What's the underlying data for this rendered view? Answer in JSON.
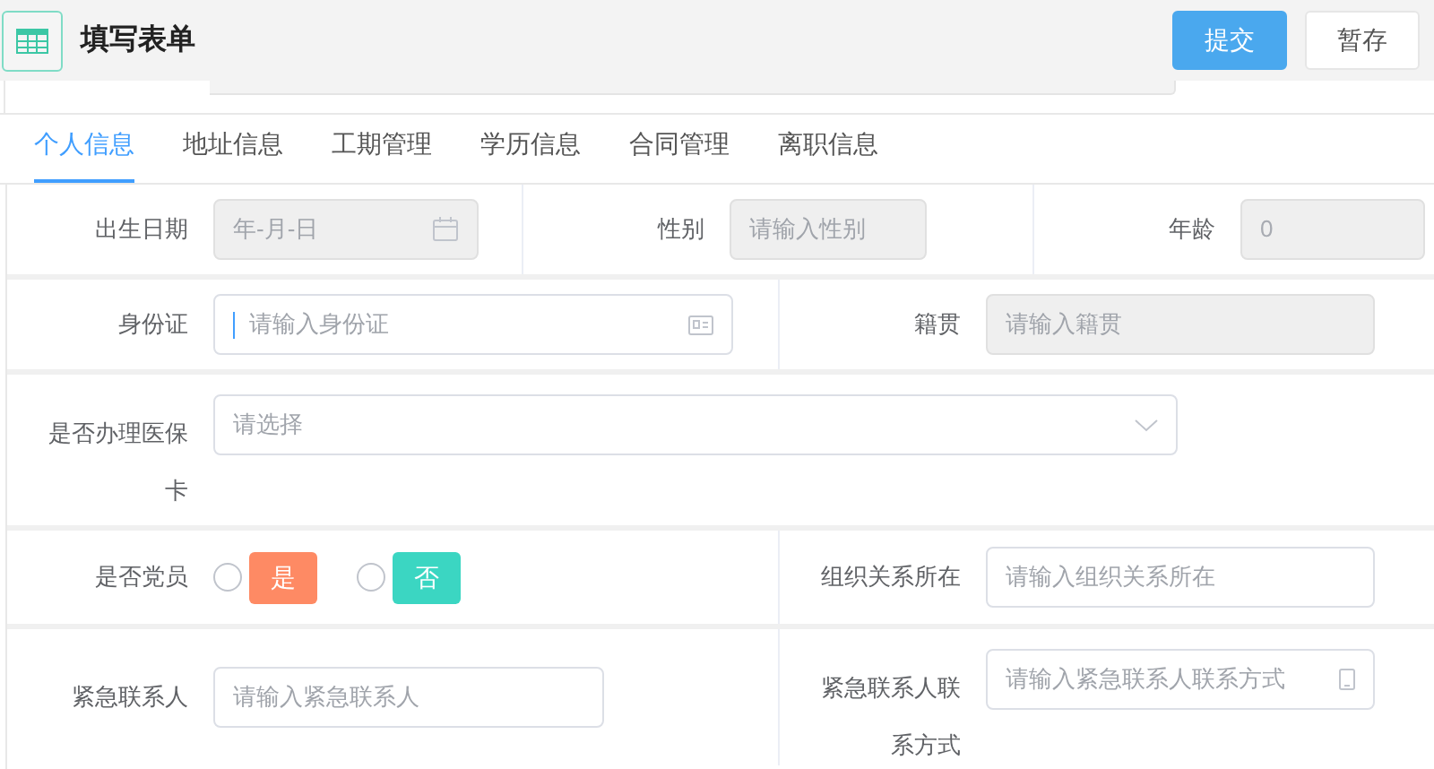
{
  "header": {
    "title": "填写表单",
    "buttons": [
      {
        "label": "提交",
        "kind": "primary"
      },
      {
        "label": "暂存",
        "kind": "default"
      }
    ]
  },
  "tabs": [
    {
      "label": "个人信息",
      "selected": true
    },
    {
      "label": "地址信息",
      "selected": false
    },
    {
      "label": "工期管理",
      "selected": false
    },
    {
      "label": "学历信息",
      "selected": false
    },
    {
      "label": "合同管理",
      "selected": false
    },
    {
      "label": "离职信息",
      "selected": false
    }
  ],
  "rows": [
    {
      "cells": [
        {
          "label": "出生日期",
          "kind": "date",
          "placeholder": "年-月-日",
          "disabled": true
        },
        {
          "label": "性别",
          "kind": "text",
          "placeholder": "请输入性别",
          "disabled": true
        },
        {
          "label": "年龄",
          "kind": "text",
          "value": "0",
          "disabled": true
        }
      ]
    },
    {
      "cells": [
        {
          "label": "身份证",
          "kind": "idcard",
          "placeholder": "请输入身份证",
          "disabled": false,
          "focused": true
        },
        {
          "label": "籍贯",
          "kind": "text",
          "placeholder": "请输入籍贯",
          "disabled": true
        }
      ]
    },
    {
      "cells": [
        {
          "label": "是否办理医保卡",
          "kind": "select",
          "placeholder": "请选择",
          "disabled": false
        }
      ]
    },
    {
      "cells": [
        {
          "label": "是否党员",
          "kind": "radio",
          "options": [
            {
              "label": "是",
              "color": "#fe8a64",
              "selected": false
            },
            {
              "label": "否",
              "color": "#3bd6c2",
              "selected": false
            }
          ]
        },
        {
          "label": "组织关系所在",
          "kind": "text",
          "placeholder": "请输入组织关系所在",
          "disabled": false
        }
      ]
    },
    {
      "cells": [
        {
          "label": "紧急联系人",
          "kind": "text",
          "placeholder": "请输入紧急联系人",
          "disabled": false
        },
        {
          "label": "紧急联系人联系方式",
          "kind": "phone",
          "placeholder": "请输入紧急联系人联系方式",
          "disabled": false
        }
      ]
    }
  ]
}
